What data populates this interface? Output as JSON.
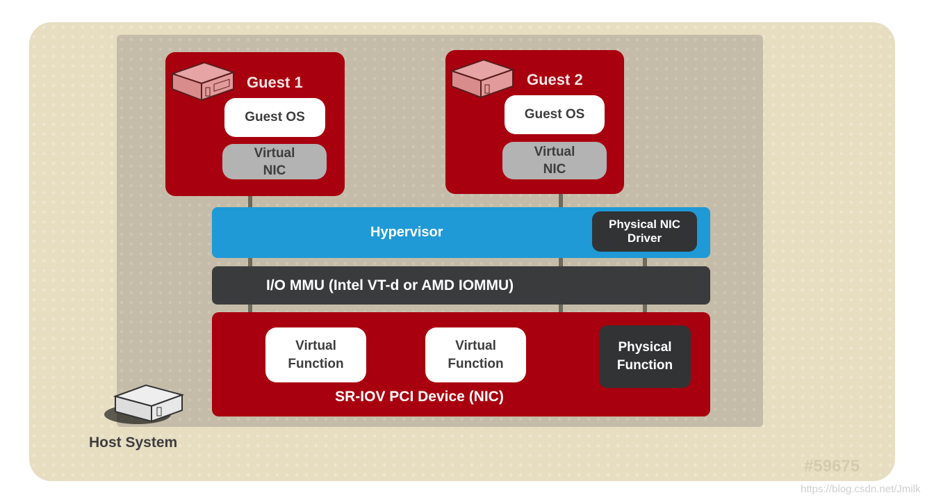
{
  "guests": [
    {
      "title": "Guest 1",
      "os": "Guest OS",
      "nic": "Virtual\nNIC"
    },
    {
      "title": "Guest 2",
      "os": "Guest OS",
      "nic": "Virtual\nNIC"
    }
  ],
  "hypervisor": {
    "label": "Hypervisor",
    "driver": "Physical NIC Driver"
  },
  "iommu": {
    "label": "I/O MMU (Intel VT-d or AMD IOMMU)"
  },
  "device": {
    "label": "SR-IOV PCI Device (NIC)",
    "vf1": "Virtual Function",
    "vf2": "Virtual Function",
    "pf": "Physical Function"
  },
  "host": {
    "label": "Host System"
  },
  "figure_id": "#59675",
  "watermark": "https://blog.csdn.net/Jmilk",
  "colors": {
    "guest": "#a8000f",
    "hypervisor": "#1f9ad6",
    "iommu": "#3a3b3d",
    "background": "#e7dec2"
  }
}
